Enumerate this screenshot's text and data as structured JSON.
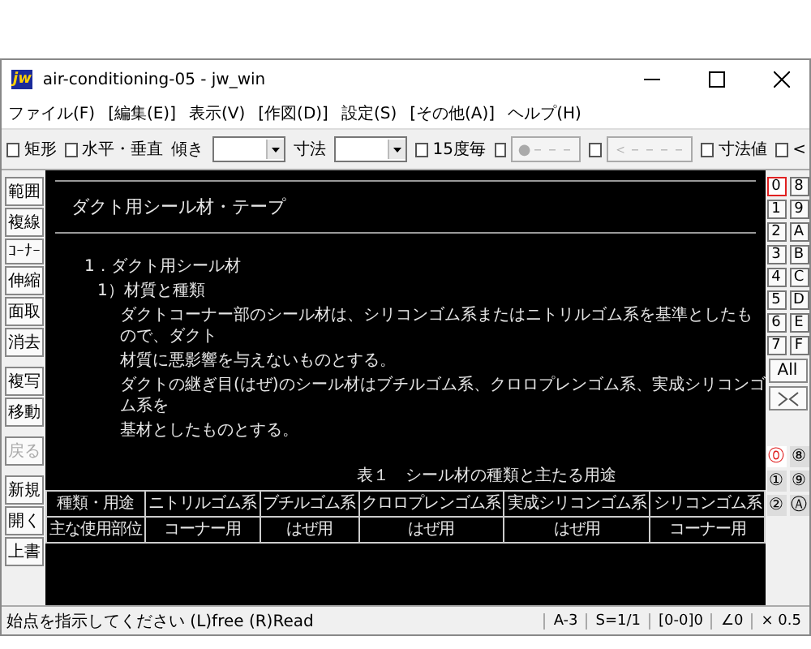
{
  "window": {
    "title": "air-conditioning-05 - jw_win",
    "icon_text": "jw"
  },
  "menu": [
    "ファイル(F)",
    "[編集(E)]",
    "表示(V)",
    "[作図(D)]",
    "設定(S)",
    "[その他(A)]",
    "ヘルプ(H)"
  ],
  "toolbar": [
    {
      "kind": "checkbox",
      "label": "矩形",
      "checked": false
    },
    {
      "kind": "checkbox",
      "label": "水平・垂直",
      "checked": false
    },
    {
      "kind": "combo",
      "label": "傾き"
    },
    {
      "kind": "combo",
      "label": "寸法"
    },
    {
      "kind": "checkbox",
      "label": "15度毎",
      "checked": false
    },
    {
      "kind": "checkbox",
      "checked": false
    },
    {
      "kind": "button",
      "label": "●－－－",
      "disabled": true
    },
    {
      "kind": "checkbox",
      "checked": false
    },
    {
      "kind": "button",
      "label": "＜－－－－",
      "disabled": true
    },
    {
      "kind": "checkbox",
      "label": "寸法値",
      "checked": false
    },
    {
      "kind": "checkbox",
      "label": "<",
      "checked": false
    }
  ],
  "left_tools": [
    [
      {
        "label": "範囲",
        "disabled": false
      },
      {
        "label": "複線",
        "disabled": false
      },
      {
        "label": "ｺｰﾅｰ",
        "disabled": false
      },
      {
        "label": "伸縮",
        "disabled": false
      },
      {
        "label": "面取",
        "disabled": false
      },
      {
        "label": "消去",
        "disabled": false
      }
    ],
    [
      {
        "label": "複写",
        "disabled": false
      },
      {
        "label": "移動",
        "disabled": false
      }
    ],
    [
      {
        "label": "戻る",
        "disabled": true
      }
    ],
    [
      {
        "label": "新規",
        "disabled": false
      },
      {
        "label": "開く",
        "disabled": false
      },
      {
        "label": "上書",
        "disabled": false
      }
    ]
  ],
  "canvas": {
    "heading": "ダクト用シール材・テープ",
    "lines": [
      {
        "kind": "section",
        "text": "1．ダクト用シール材"
      },
      {
        "kind": "subsection",
        "text": "1）材質と種類"
      },
      {
        "kind": "body",
        "text": "ダクトコーナー部のシール材は、シリコンゴム系またはニトリルゴム系を基準としたもので、ダクト"
      },
      {
        "kind": "body",
        "text": "材質に悪影響を与えないものとする。"
      },
      {
        "kind": "body",
        "text": "ダクトの継ぎ目(はぜ)のシール材はブチルゴム系、クロロプレンゴム系、実成シリコンゴム系を"
      },
      {
        "kind": "body",
        "text": "基材としたものとする。"
      }
    ],
    "table": {
      "caption": "表１　シール材の種類と主たる用途",
      "columns": [
        "種類・用途",
        "ニトリルゴム系",
        "ブチルゴム系",
        "クロロプレンゴム系",
        "実成シリコンゴム系",
        "シリコンゴム系"
      ],
      "rows": [
        [
          "主な使用部位",
          "コーナー用",
          "はぜ用",
          "はぜ用",
          "はぜ用",
          "コーナー用"
        ]
      ]
    }
  },
  "layers": [
    {
      "label": "0",
      "selected": true
    },
    {
      "label": "8",
      "selected": false
    },
    {
      "label": "1",
      "selected": false
    },
    {
      "label": "9",
      "selected": false
    },
    {
      "label": "2",
      "selected": false
    },
    {
      "label": "A",
      "selected": false
    },
    {
      "label": "3",
      "selected": false
    },
    {
      "label": "B",
      "selected": false
    },
    {
      "label": "4",
      "selected": false
    },
    {
      "label": "C",
      "selected": false
    },
    {
      "label": "5",
      "selected": false
    },
    {
      "label": "D",
      "selected": false
    },
    {
      "label": "6",
      "selected": false
    },
    {
      "label": "E",
      "selected": false
    },
    {
      "label": "7",
      "selected": false
    },
    {
      "label": "F",
      "selected": false
    }
  ],
  "all_button": "All",
  "layer_groups": [
    {
      "label": "⓪",
      "selected": true
    },
    {
      "label": "⑧",
      "selected": false
    },
    {
      "label": "①",
      "selected": false
    },
    {
      "label": "⑨",
      "selected": false
    },
    {
      "label": "②",
      "selected": false
    },
    {
      "label": "Ⓐ",
      "selected": false
    }
  ],
  "status_bar": {
    "message": "始点を指示してください (L)free (R)Read",
    "cells": [
      "A-3",
      "S=1/1",
      "[0-0]0",
      "∠0",
      "× 0.5"
    ]
  }
}
